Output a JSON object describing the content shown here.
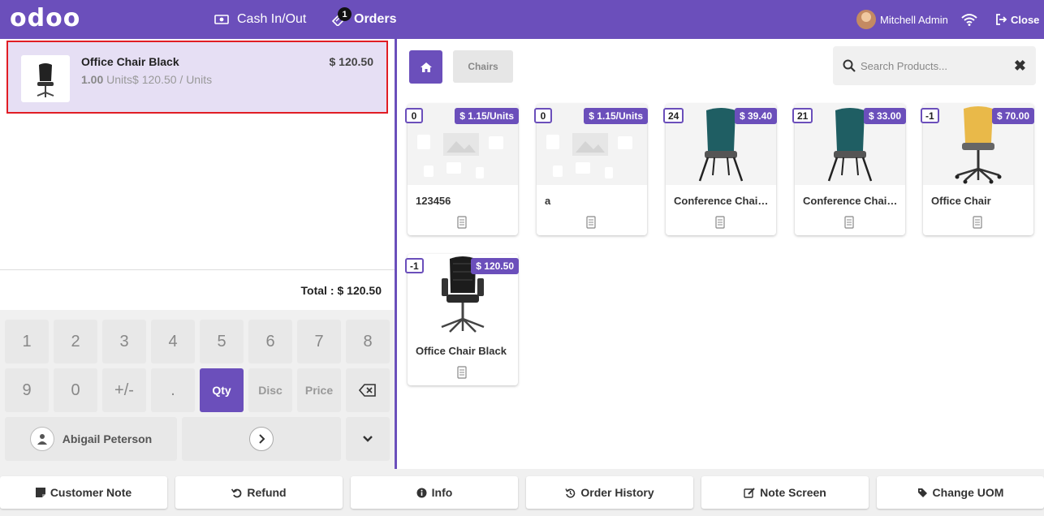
{
  "header": {
    "logo": "odoo",
    "cash_label": "Cash In/Out",
    "orders_label": "Orders",
    "orders_count": "1",
    "user_name": "Mitchell Admin",
    "close_label": "Close"
  },
  "order": {
    "line": {
      "name": "Office Chair Black",
      "price": "$ 120.50",
      "qty": "1.00",
      "unit_info": " Units$ 120.50 / Units"
    },
    "total_label": "Total :",
    "total_value": "$ 120.50"
  },
  "numpad": {
    "keys_row1": [
      "1",
      "2",
      "3",
      "4",
      "5",
      "6",
      "7",
      "8"
    ],
    "keys_row2": [
      "9",
      "0",
      "+/-",
      "."
    ],
    "qty": "Qty",
    "disc": "Disc",
    "price": "Price",
    "customer": "Abigail Peterson"
  },
  "products": {
    "breadcrumb": "Chairs",
    "search_placeholder": "Search Products...",
    "items": [
      {
        "name": "123456",
        "price": "$ 1.15/Units",
        "stock": "0"
      },
      {
        "name": "a",
        "price": "$ 1.15/Units",
        "stock": "0"
      },
      {
        "name": "Conference Chair (Steel)",
        "price": "$ 39.40",
        "stock": "24"
      },
      {
        "name": "Conference Chair (Aluminium)",
        "price": "$ 33.00",
        "stock": "21"
      },
      {
        "name": "Office Chair",
        "price": "$ 70.00",
        "stock": "-1"
      },
      {
        "name": "Office Chair Black",
        "price": "$ 120.50",
        "stock": "-1"
      }
    ]
  },
  "actions": {
    "customer_note": "Customer Note",
    "refund": "Refund",
    "info": "Info",
    "order_history": "Order History",
    "note_screen": "Note Screen",
    "change_uom": "Change UOM"
  },
  "colors": {
    "brand": "#6b4fbb",
    "selected_line": "#e6dff4",
    "highlight_border": "#e11d24"
  }
}
